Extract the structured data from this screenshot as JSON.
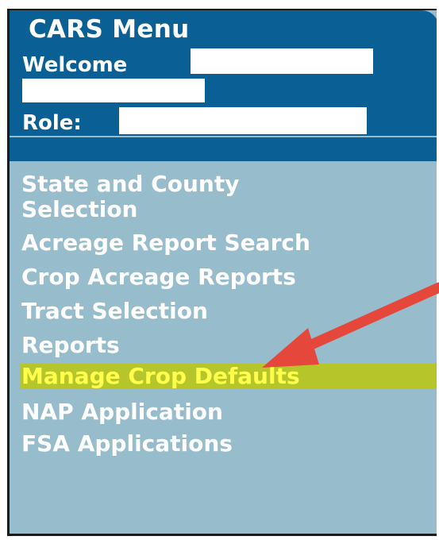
{
  "menu": {
    "title": "CARS Menu",
    "welcome_label": "Welcome",
    "role_label": "Role:",
    "items": [
      {
        "label": "State and County",
        "label2": "Selection"
      },
      {
        "label": "Acreage Report Search"
      },
      {
        "label": "Crop Acreage Reports"
      },
      {
        "label": "Tract Selection"
      },
      {
        "label": "Reports"
      },
      {
        "label": "Manage Crop Defaults"
      },
      {
        "label": "NAP Application"
      },
      {
        "label": "FSA Applications"
      }
    ]
  },
  "colors": {
    "header": "#0a5f95",
    "panel": "#97bccb",
    "highlight_bg": "#b6c62a",
    "highlight_text": "#ffff4d",
    "arrow": "#e5473b"
  },
  "annotations": {
    "arrow_icon": "red-arrow-icon"
  }
}
